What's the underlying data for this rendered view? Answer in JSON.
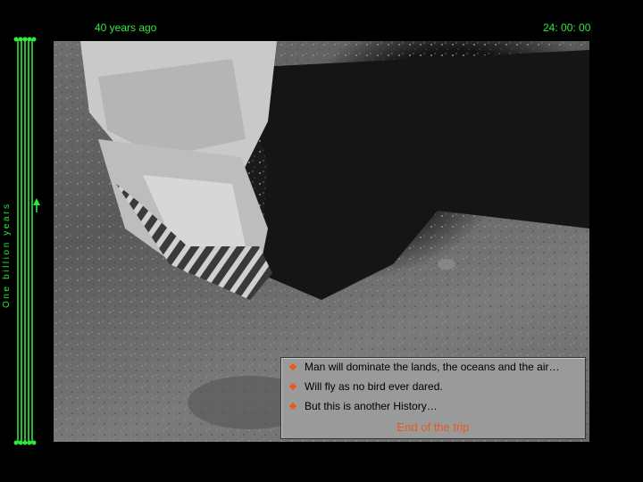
{
  "header": {
    "left_text": "40 years ago",
    "right_text": "24: 00: 00"
  },
  "sidebar": {
    "vertical_label": "One billion years"
  },
  "photo": {
    "subject": "boot-print-on-lunar-surface"
  },
  "caption": {
    "bullets": [
      "Man will dominate the lands, the oceans and the air…",
      "Will fly as no bird ever dared.",
      "But this is another History…"
    ],
    "end_label": "End of the trip"
  },
  "colors": {
    "accent_green": "#2ee83a",
    "bullet_orange": "#e85a1a",
    "caption_bg": "#9a9a9a"
  }
}
